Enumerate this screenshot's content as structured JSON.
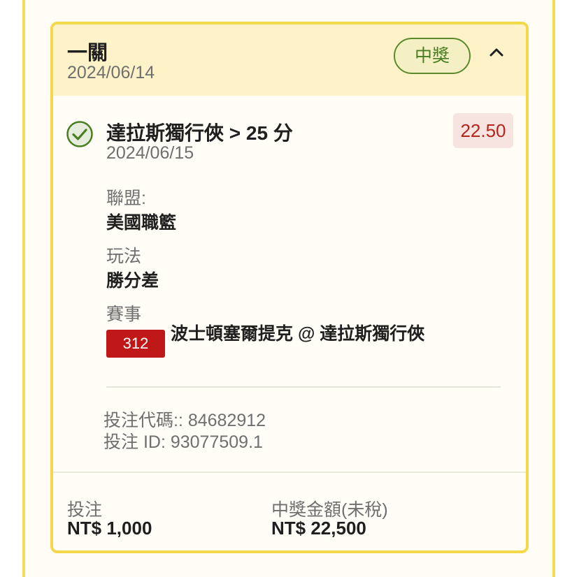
{
  "header": {
    "bet_type": "一關",
    "date": "2024/06/14",
    "status": "中獎",
    "collapse_icon": "chevron-up-icon"
  },
  "selection": {
    "result_icon": "check-circle-icon",
    "name": "達拉斯獨行俠 > 25 分",
    "date": "2024/06/15",
    "odds": "22.50",
    "league_label": "聯盟:",
    "league_value": "美國職籃",
    "market_label": "玩法",
    "market_value": "勝分差",
    "event_label": "賽事",
    "event_id": "312",
    "event_name": "波士頓塞爾提克 @ 達拉斯獨行俠"
  },
  "bet_info": {
    "code": "投注代碼:: 84682912",
    "id": "投注 ID: 93077509.1"
  },
  "footer": {
    "stake_label": "投注",
    "stake_value": "NT$ 1,000",
    "payout_label": "中獎金額(未稅)",
    "payout_value": "NT$ 22,500"
  },
  "colors": {
    "accent_yellow": "#f5d84a",
    "header_bg": "#fdf2c8",
    "win_green": "#4a7d22",
    "odds_red": "#b3261e",
    "event_badge_red": "#c01818"
  }
}
